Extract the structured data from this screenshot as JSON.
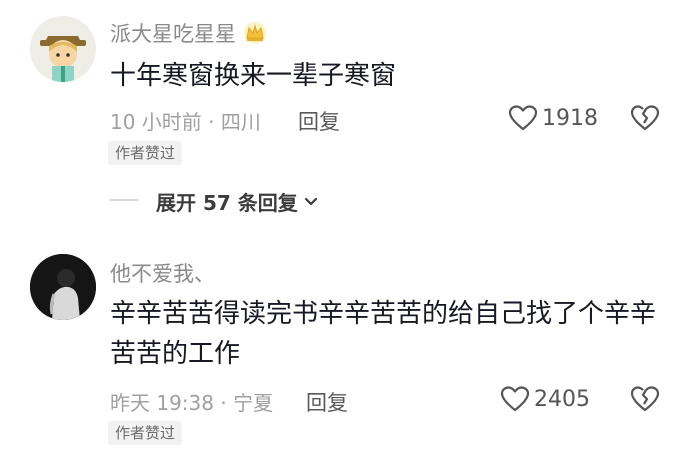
{
  "comments": [
    {
      "username": "派大星吃星星",
      "content_lines": [
        "十年寒窗换来一辈子寒窗"
      ],
      "time_location": "10 小时前 · 四川",
      "reply_label": "回复",
      "likes": "1918",
      "author_tag": "作者赞过"
    },
    {
      "username": "他不爱我、",
      "content_lines": [
        "辛辛苦苦得读完书辛辛苦苦的给自己找了个辛辛",
        "苦苦的工作"
      ],
      "time_location": "昨天 19:38 · 宁夏",
      "reply_label": "回复",
      "likes": "2405",
      "author_tag": "作者赞过"
    }
  ],
  "expand_replies": {
    "label": "展开 57 条回复"
  },
  "colors": {
    "text": "#161823",
    "meta": "#a0a0a0",
    "tag_bg": "#f2f2f2"
  }
}
